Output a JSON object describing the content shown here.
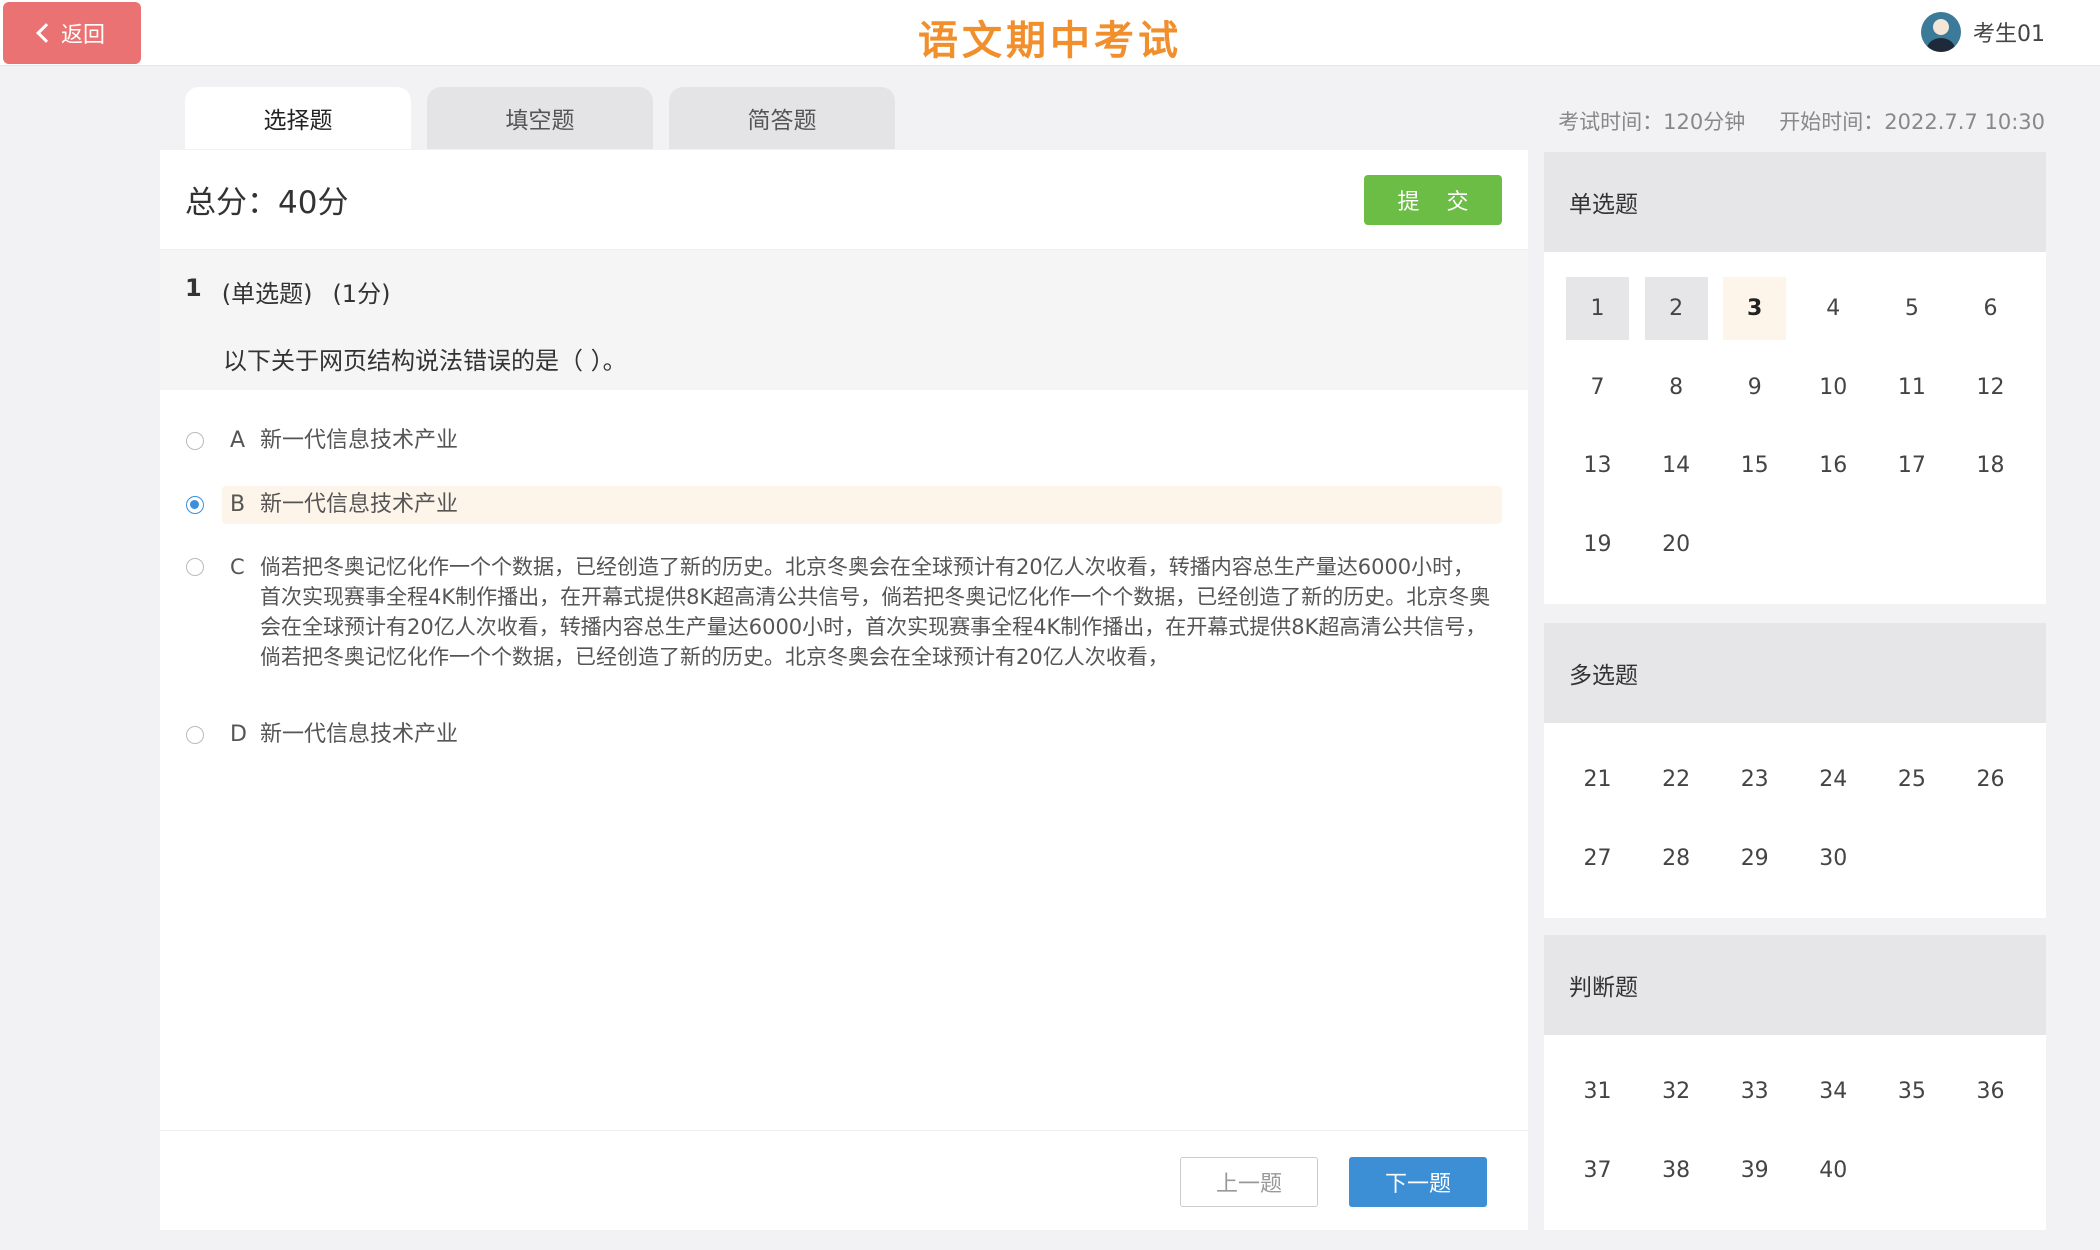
{
  "header": {
    "back_label": "返回",
    "title": "语文期中考试",
    "user_name": "考生01"
  },
  "tabs": [
    {
      "label": "选择题",
      "active": true
    },
    {
      "label": "填空题",
      "active": false
    },
    {
      "label": "简答题",
      "active": false
    }
  ],
  "meta": {
    "duration": "考试时间：120分钟",
    "start_time": "开始时间：2022.7.7 10:30"
  },
  "main": {
    "total_score": "总分：40分",
    "submit_label": "提 交",
    "question": {
      "number": "1",
      "type": "(单选题)",
      "points": "(1分)",
      "text": "以下关于网页结构说法错误的是（ ）。"
    },
    "options": [
      {
        "letter": "A",
        "text": "新一代信息技术产业",
        "selected": false
      },
      {
        "letter": "B",
        "text": "新一代信息技术产业",
        "selected": true
      },
      {
        "letter": "C",
        "text": "倘若把冬奥记忆化作一个个数据，已经创造了新的历史。北京冬奥会在全球预计有20亿人次收看，转播内容总生产量达6000小时，首次实现赛事全程4K制作播出，在开幕式提供8K超高清公共信号，倘若把冬奥记忆化作一个个数据，已经创造了新的历史。北京冬奥会在全球预计有20亿人次收看，转播内容总生产量达6000小时，首次实现赛事全程4K制作播出，在开幕式提供8K超高清公共信号，倘若把冬奥记忆化作一个个数据，已经创造了新的历史。北京冬奥会在全球预计有20亿人次收看，",
        "selected": false
      },
      {
        "letter": "D",
        "text": "新一代信息技术产业",
        "selected": false
      }
    ],
    "prev_label": "上一题",
    "next_label": "下一题"
  },
  "sidebar": {
    "sections": [
      {
        "title": "单选题",
        "numbers": [
          "1",
          "2",
          "3",
          "4",
          "5",
          "6",
          "7",
          "8",
          "9",
          "10",
          "11",
          "12",
          "13",
          "14",
          "15",
          "16",
          "17",
          "18",
          "19",
          "20"
        ],
        "answered": [
          "1",
          "2"
        ],
        "current": "3"
      },
      {
        "title": "多选题",
        "numbers": [
          "21",
          "22",
          "23",
          "24",
          "25",
          "26",
          "27",
          "28",
          "29",
          "30"
        ],
        "answered": [],
        "current": ""
      },
      {
        "title": "判断题",
        "numbers": [
          "31",
          "32",
          "33",
          "34",
          "35",
          "36",
          "37",
          "38",
          "39",
          "40"
        ],
        "answered": [],
        "current": ""
      }
    ]
  },
  "colors": {
    "title_orange": "#f08f2c",
    "back_red": "#ea7272",
    "submit_green": "#6cbd45",
    "next_blue": "#3c8fd4",
    "radio_blue": "#3d8fdb",
    "highlight": "#fdf4ea"
  }
}
